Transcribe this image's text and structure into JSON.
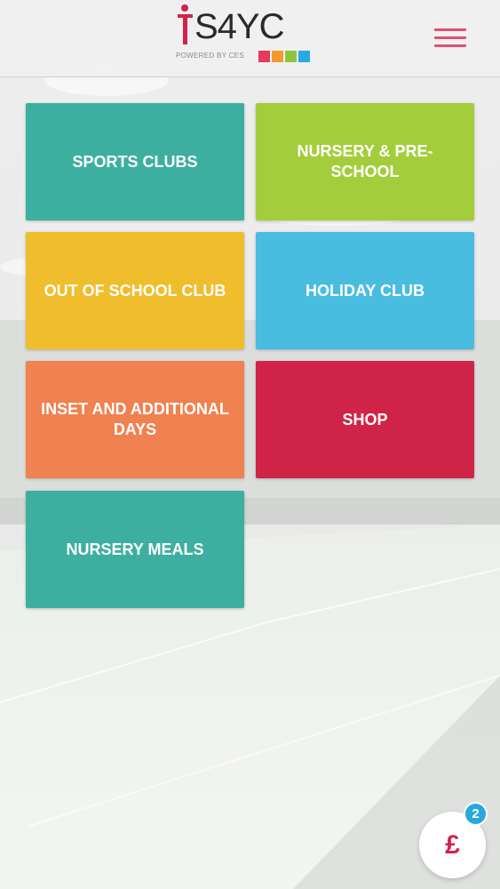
{
  "header": {
    "logo_text": "S4YC",
    "logo_subtitle": "POWERED BY CES",
    "logo_colors": [
      "#e53b5a",
      "#f39a2b",
      "#8cc63f",
      "#27a9e1"
    ],
    "logo_accent": "#d1234b",
    "menu_icon": "hamburger-menu-icon",
    "menu_color": "#e05071"
  },
  "tiles": [
    {
      "label": "SPORTS CLUBS",
      "color": "#3dafa0"
    },
    {
      "label": "NURSERY & PRE-SCHOOL",
      "color": "#a4cd3c"
    },
    {
      "label": "OUT OF SCHOOL CLUB",
      "color": "#f0bd2c"
    },
    {
      "label": "HOLIDAY CLUB",
      "color": "#48bde0"
    },
    {
      "label": "INSET AND ADDITIONAL DAYS",
      "color": "#f08150"
    },
    {
      "label": "SHOP",
      "color": "#cf2448"
    },
    {
      "label": "NURSERY MEALS",
      "color": "#3dafa0"
    }
  ],
  "basket": {
    "symbol": "£",
    "count": "2",
    "icon": "pound-currency-icon",
    "badge_color": "#2aa8dc"
  }
}
